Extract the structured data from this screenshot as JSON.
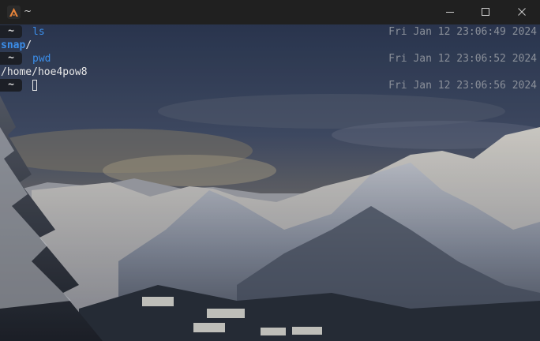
{
  "window": {
    "title": "~",
    "controls": {
      "minimize_icon": "minimize-icon",
      "maximize_icon": "maximize-icon",
      "close_icon": "close-icon"
    }
  },
  "terminal": {
    "prompt_symbol": "~",
    "entries": [
      {
        "command": "ls",
        "timestamp": "Fri Jan 12 23:06:49 2024",
        "output_dir": "snap",
        "output_suffix": "/"
      },
      {
        "command": "pwd",
        "timestamp": "Fri Jan 12 23:06:52 2024",
        "output": "/home/hoe4pow8"
      },
      {
        "command": "",
        "timestamp": "Fri Jan 12 23:06:56 2024"
      }
    ]
  },
  "colors": {
    "command": "#3b8eea",
    "timestamp": "#8a8f99",
    "titlebar": "#202020"
  }
}
